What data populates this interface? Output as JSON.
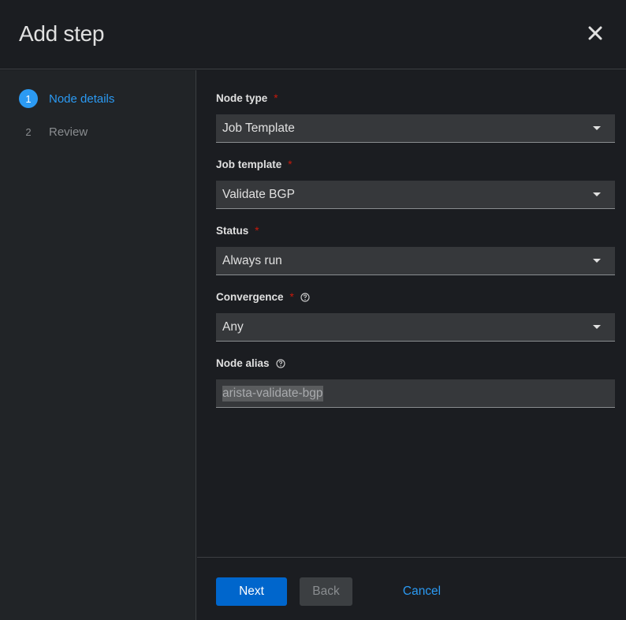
{
  "modal": {
    "title": "Add step",
    "close_icon": "close-icon"
  },
  "wizard_nav": {
    "items": [
      {
        "number": "1",
        "label": "Node details",
        "state": "active"
      },
      {
        "number": "2",
        "label": "Review",
        "state": "inactive"
      }
    ]
  },
  "form": {
    "node_type": {
      "label": "Node type",
      "required": "*",
      "value": "Job Template"
    },
    "job_template": {
      "label": "Job template",
      "required": "*",
      "value": "Validate BGP"
    },
    "status": {
      "label": "Status",
      "required": "*",
      "value": "Always run"
    },
    "convergence": {
      "label": "Convergence",
      "required": "*",
      "value": "Any",
      "help_icon": "help-icon"
    },
    "node_alias": {
      "label": "Node alias",
      "value": "arista-validate-bgp",
      "help_icon": "help-icon"
    }
  },
  "footer": {
    "next_label": "Next",
    "back_label": "Back",
    "cancel_label": "Cancel"
  },
  "colors": {
    "accent": "#2b9af3",
    "primary_button": "#0066cc",
    "required": "#c9190b",
    "background": "#1b1d21"
  }
}
